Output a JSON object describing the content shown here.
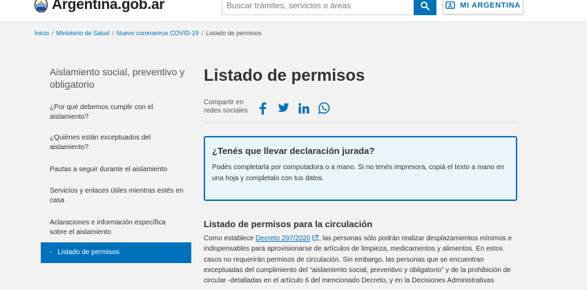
{
  "header": {
    "logo_text": "Argentina.gob.ar",
    "search_placeholder": "Buscar trámites, servicios o áreas",
    "mi_argentina_label": "MI ARGENTINA"
  },
  "breadcrumb": [
    {
      "label": "Inicio",
      "link": true
    },
    {
      "label": "Ministerio de Salud",
      "link": true
    },
    {
      "label": "Nuevo coronavirus COVID-19",
      "link": true
    },
    {
      "label": "Listado de permisos",
      "link": false
    }
  ],
  "sidebar": {
    "title": "Aislamiento social, preventivo y obligatorio",
    "items": [
      {
        "label": "¿Por qué debemos cumplir con el aislamiento?"
      },
      {
        "label": "¿Quiénes están exceptuados del aislamiento?"
      },
      {
        "label": "Pautas a seguir durante el aislamiento"
      },
      {
        "label": "Servicios y enlaces útiles mientras estés en casa"
      },
      {
        "label": "Aclaraciones e información específica sobre el aislamiento"
      },
      {
        "label": "Listado de permisos",
        "active": true
      }
    ],
    "active_prefix": "-"
  },
  "main": {
    "title": "Listado de permisos",
    "share_label": "Compartir en redes sociales",
    "share_icons": [
      "facebook-icon",
      "twitter-icon",
      "linkedin-icon",
      "whatsapp-icon"
    ],
    "alert": {
      "title": "¿Tenés que llevar declaración jurada?",
      "text": "Podés completarla por computadora o a mano. Si no tenés impresora, copiá el texto a mano en una hoja y completalo con tus datos."
    },
    "section_title": "Listado de permisos para la circulación",
    "body_before_link": "Como establece ",
    "body_link": "Decreto 297/2020",
    "body_after_link": ", las personas sólo podrán realizar desplazamientos mínimos e indispensables para aprovisionarse de artículos de limpieza, medicamentos y alimentos. En estos casos no requerirán permisos de circulación. Sin embargo, las personas que se encuentran exceptuadas del cumplimiento del “aislamiento social, preventivo y obligatorio” y de la prohibición de circular -detalladas en el artículo 6 del mencionado Decreto, y en la Decisiones Administrativas"
  },
  "colors": {
    "primary": "#0072bb",
    "page_bg": "#f2f2f2",
    "alert_bg": "#eaf5fb"
  }
}
